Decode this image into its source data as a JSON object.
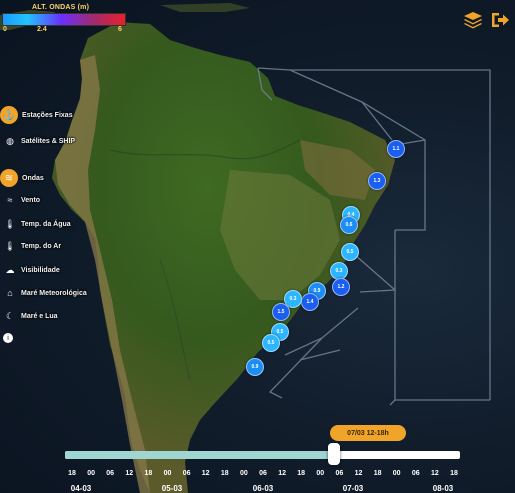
{
  "legend": {
    "title": "ALT. ONDAS (m)",
    "ticks": [
      "0",
      "2.4",
      "6"
    ],
    "colors": [
      "#1a9bff",
      "#22c3ff",
      "#6a2eff",
      "#a42a6a",
      "#e8202a"
    ]
  },
  "top_icons": {
    "layers": "layers-icon",
    "logout": "logout-icon"
  },
  "menu": {
    "items": [
      {
        "label": "Estações Fixas",
        "icon": "anchor-icon",
        "active": true
      },
      {
        "label": "Satélites & SHIP",
        "icon": "globe-icon",
        "active": false
      },
      {
        "label": "Ondas",
        "icon": "waves-icon",
        "active": true
      },
      {
        "label": "Vento",
        "icon": "wind-icon",
        "active": false
      },
      {
        "label": "Temp. da Água",
        "icon": "thermometer-icon",
        "active": false
      },
      {
        "label": "Temp. do Ar",
        "icon": "air-temperature-icon",
        "active": false
      },
      {
        "label": "Visibilidade",
        "icon": "fog-icon",
        "active": false
      },
      {
        "label": "Maré Meteorológica",
        "icon": "tide-icon",
        "active": false
      },
      {
        "label": "Maré e Lua",
        "icon": "moon-icon",
        "active": false
      },
      {
        "label": "",
        "icon": "info-icon",
        "active": false
      }
    ]
  },
  "markers": [
    {
      "label": "1.1",
      "value": 1.1
    },
    {
      "label": "1.3",
      "value": 1.3
    },
    {
      "label": "0.4",
      "value": 0.4
    },
    {
      "label": "0.6",
      "value": 0.6
    },
    {
      "label": "0.5",
      "value": 0.5
    },
    {
      "label": "0.3",
      "value": 0.3
    },
    {
      "label": "1.2",
      "value": 1.2
    },
    {
      "label": "0.9",
      "value": 0.9
    },
    {
      "label": "1.4",
      "value": 1.4
    },
    {
      "label": "0.3",
      "value": 0.3
    },
    {
      "label": "1.5",
      "value": 1.5
    },
    {
      "label": "0.5",
      "value": 0.5
    },
    {
      "label": "0.5",
      "value": 0.5
    },
    {
      "label": "0.9",
      "value": 0.9
    }
  ],
  "timeline": {
    "current": "07/03 12-18h",
    "progress": 0.68,
    "hours": [
      "18",
      "00",
      "06",
      "12",
      "18",
      "00",
      "06",
      "12",
      "18",
      "00",
      "06",
      "12",
      "18",
      "00",
      "06",
      "12",
      "18",
      "00",
      "06",
      "12",
      "18"
    ],
    "dates": [
      "04-03",
      "05-03",
      "06-03",
      "07-03",
      "08-03"
    ]
  }
}
